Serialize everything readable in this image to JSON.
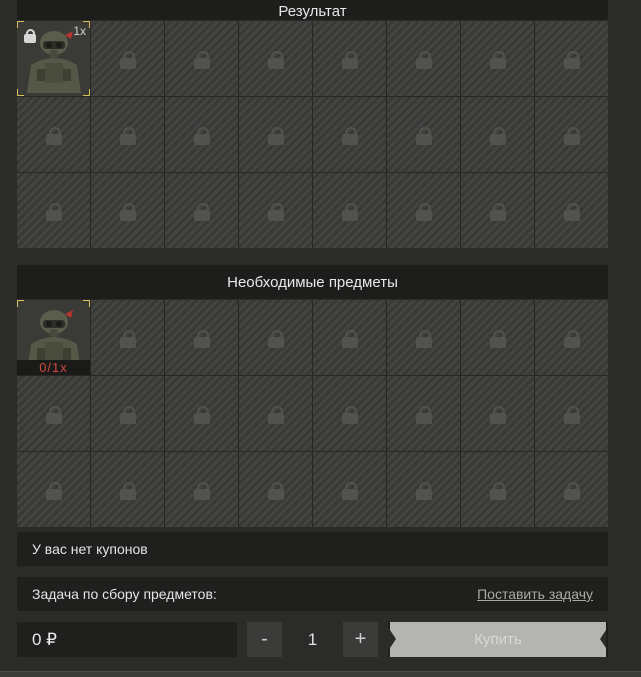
{
  "result": {
    "title": "Результат",
    "item": {
      "name": "soldier-armor-icon",
      "quantity": "1x"
    },
    "slots": 24
  },
  "required": {
    "title": "Необходимые предметы",
    "item": {
      "name": "soldier-armor-icon",
      "count": "0/1x"
    },
    "slots": 24
  },
  "coupons": {
    "text": "У вас нет купонов"
  },
  "task": {
    "label": "Задача по сбору предметов:",
    "link": "Поставить задачу"
  },
  "purchase": {
    "price": "0 ₽",
    "minus": "-",
    "quantity": "1",
    "plus": "+",
    "buy_label": "Купить"
  },
  "colors": {
    "accent_frame": "#d8c15a",
    "need_count": "#d0493f",
    "buy_button": "#b4b4b2"
  }
}
